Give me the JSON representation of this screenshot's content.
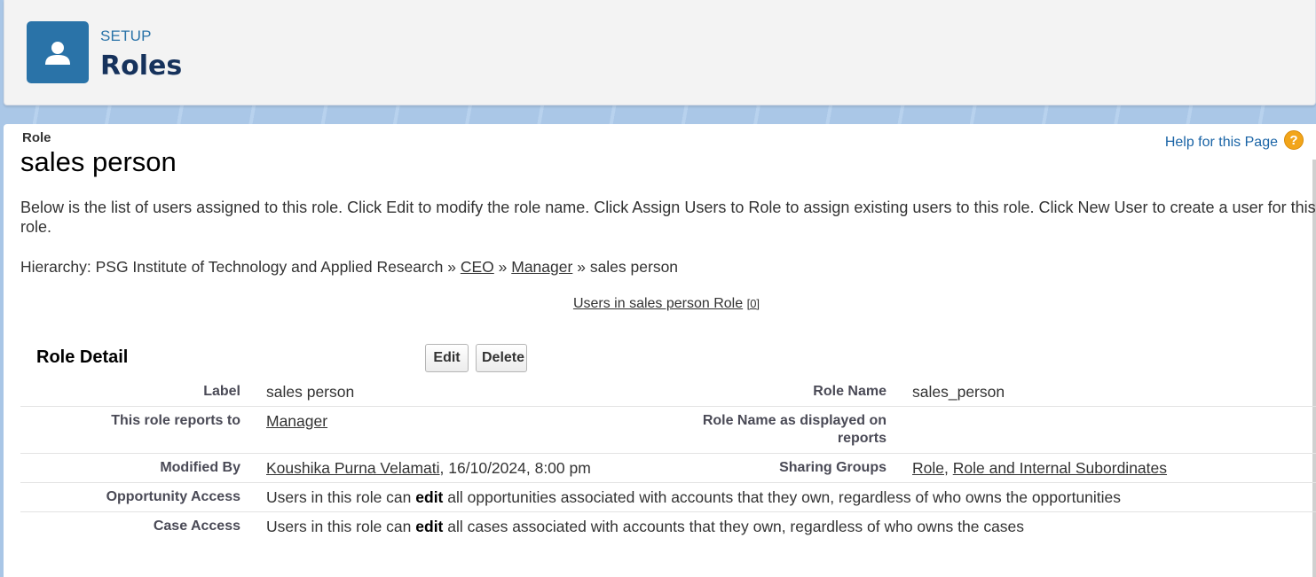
{
  "header": {
    "eyebrow": "SETUP",
    "title": "Roles",
    "icon": "user-icon"
  },
  "page": {
    "type_label": "Role",
    "title": "sales person",
    "help_link": "Help for this Page",
    "help_icon": "question-icon",
    "description": "Below is the list of users assigned to this role. Click Edit to modify the role name. Click Assign Users to Role to assign existing users to this role. Click New User to create a user for this role."
  },
  "hierarchy": {
    "prefix": "Hierarchy: PSG Institute of Technology and Applied Research",
    "sep": "»",
    "ceo": "CEO",
    "manager": "Manager",
    "current": "sales person"
  },
  "users_link": {
    "label": "Users in sales person Role",
    "count": "[0]"
  },
  "role_detail": {
    "section_title": "Role Detail",
    "edit_label": "Edit",
    "delete_label": "Delete",
    "label_label": "Label",
    "label_value": "sales person",
    "role_name_label": "Role Name",
    "role_name_value": "sales_person",
    "reports_to_label": "This role reports to",
    "reports_to_value": "Manager",
    "role_name_reports_label": "Role Name as displayed on reports",
    "modified_by_label": "Modified By",
    "modified_by_user": "Koushika Purna Velamati",
    "modified_by_date": ", 16/10/2024, 8:00 pm",
    "sharing_groups_label": "Sharing Groups",
    "sharing_group_1": "Role",
    "sharing_sep": ", ",
    "sharing_group_2": "Role and Internal Subordinates",
    "opportunity_label": "Opportunity Access",
    "opportunity_pre": "Users in this role can ",
    "opportunity_bold": "edit",
    "opportunity_post": " all opportunities associated with accounts that they own, regardless of who owns the opportunities",
    "case_label": "Case Access",
    "case_pre": "Users in this role can ",
    "case_bold": "edit",
    "case_post": " all cases associated with accounts that they own, regardless of who owns the cases"
  },
  "colors": {
    "header_icon_bg": "#2a73a8",
    "link_blue": "#1a64a6",
    "help_icon": "#f2a51a"
  }
}
